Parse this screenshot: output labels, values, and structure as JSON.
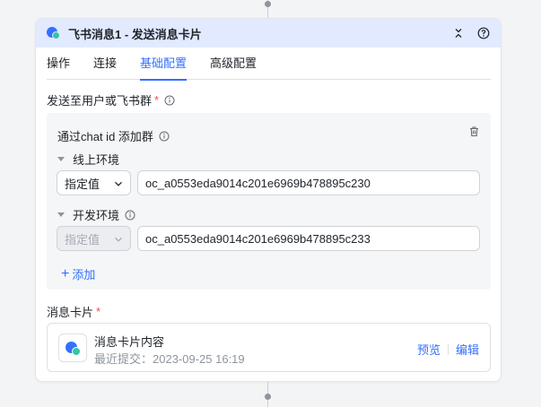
{
  "header": {
    "title": "飞书消息1 - 发送消息卡片",
    "collapse_icon": "collapse-icon",
    "help_icon": "help-icon"
  },
  "tabs": [
    {
      "label": "操作",
      "active": false
    },
    {
      "label": "连接",
      "active": false
    },
    {
      "label": "基础配置",
      "active": true
    },
    {
      "label": "高级配置",
      "active": false
    }
  ],
  "recipient": {
    "label": "发送至用户或飞书群",
    "required_mark": "*",
    "group_panel": {
      "title": "通过chat id 添加群",
      "online_env": {
        "label": "线上环境",
        "select_value": "指定值",
        "input_value": "oc_a0553eda9014c201e6969b478895c230"
      },
      "dev_env": {
        "label": "开发环境",
        "select_value": "指定值",
        "input_value": "oc_a0553eda9014c201e6969b478895c233"
      },
      "add_label": "添加",
      "add_symbol": "+"
    }
  },
  "message_card": {
    "label": "消息卡片",
    "required_mark": "*",
    "title": "消息卡片内容",
    "subtitle": "最近提交：2023-09-25 16:19",
    "preview_label": "预览",
    "edit_label": "编辑"
  },
  "colors": {
    "accent": "#3370ff",
    "header_bg": "#e1eaff",
    "required": "#f54a45"
  }
}
